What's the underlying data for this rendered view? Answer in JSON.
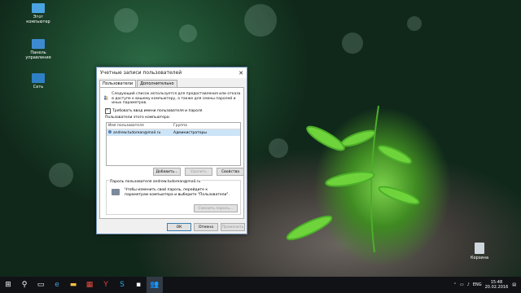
{
  "desktop": {
    "icons": [
      {
        "label": "Этот компьютер",
        "icon": "computer-icon"
      },
      {
        "label": "Панель управления",
        "icon": "control-panel-icon"
      },
      {
        "label": "Сеть",
        "icon": "network-icon"
      }
    ],
    "recycle_bin": "Корзина"
  },
  "dialog": {
    "title": "Учетные записи пользователей",
    "tabs": [
      "Пользователи",
      "Дополнительно"
    ],
    "intro_text": "Следующий список используется для предоставления или отказа в доступе к вашему компьютеру, а также для смены паролей и иных параметров.",
    "require_login_checkbox": "Требовать ввод имени пользователя и пароля",
    "users_label": "Пользователи этого компьютера:",
    "list": {
      "columns": [
        "Имя пользователя",
        "Группа"
      ],
      "rows": [
        {
          "user": "andrew.tudorean@mail.ru",
          "group": "Администраторы"
        }
      ]
    },
    "buttons": {
      "add": "Добавить...",
      "remove": "Удалить",
      "properties": "Свойства"
    },
    "password_group": {
      "title": "Пароль пользователя andrew.tudorean@mail.ru",
      "text": "Чтобы изменить свой пароль, перейдите к параметрам компьютера и выберите \"Пользователи\".",
      "reset_button": "Сменить пароль..."
    },
    "footer": {
      "ok": "ОК",
      "cancel": "Отмена",
      "apply": "Применить"
    }
  },
  "taskbar": {
    "language": "ENG",
    "time": "15:48",
    "date": "20.02.2016"
  }
}
